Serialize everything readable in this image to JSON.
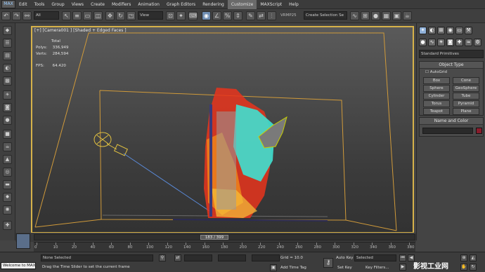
{
  "menubar": {
    "logo": "MAX",
    "items": [
      "Edit",
      "Tools",
      "Group",
      "Views",
      "Create",
      "Modifiers",
      "Animation",
      "Graph Editors",
      "Rendering",
      "Customize",
      "MAXScript",
      "Help"
    ],
    "active_index": 9
  },
  "toolbar": {
    "selection_filter": "All",
    "reference_coord": "View",
    "named_selection": "Create Selection Se",
    "ray_badge": "VRMP25"
  },
  "viewport": {
    "label": "[+] [Camera001 ] [Shaded + Edged Faces ]",
    "stats_title": "Total",
    "polys_label": "Polys:",
    "polys_value": "336,949",
    "verts_label": "Verts:",
    "verts_value": "284,594",
    "fps_label": "FPS:",
    "fps_value": "64.420"
  },
  "command_panel": {
    "category": "Standard Primitives",
    "object_type_title": "Object Type",
    "autogrid_label": "AutoGrid",
    "buttons": [
      "Box",
      "Cone",
      "Sphere",
      "GeoSphere",
      "Cylinder",
      "Tube",
      "Torus",
      "Pyramid",
      "Teapot",
      "Plane"
    ],
    "name_color_title": "Name and Color"
  },
  "timeline": {
    "slider_label": "183 / 399",
    "ticks": [
      "0",
      "10",
      "20",
      "40",
      "60",
      "80",
      "100",
      "120",
      "140",
      "160",
      "180",
      "200",
      "220",
      "240",
      "260",
      "280",
      "300",
      "320",
      "340",
      "360",
      "380"
    ]
  },
  "status": {
    "maxscript_label": "Welcome to MAX!",
    "selection": "None Selected",
    "prompt": "Drag the Time Slider to set the current frame",
    "grid": "Grid = 10.0",
    "add_time_tag": "Add Time Tag",
    "auto_key": "Auto Key",
    "set_key": "Set Key",
    "key_mode": "Selected",
    "key_filters": "Key Filters...",
    "watermark": "影视工业网"
  },
  "colors": {
    "accent_blue": "#6e8db2",
    "viewport_border": "#d6b24a",
    "particles_red": "#e8341c",
    "particles_cyan": "#3fe0d0",
    "particles_orange": "#f08a1c"
  }
}
